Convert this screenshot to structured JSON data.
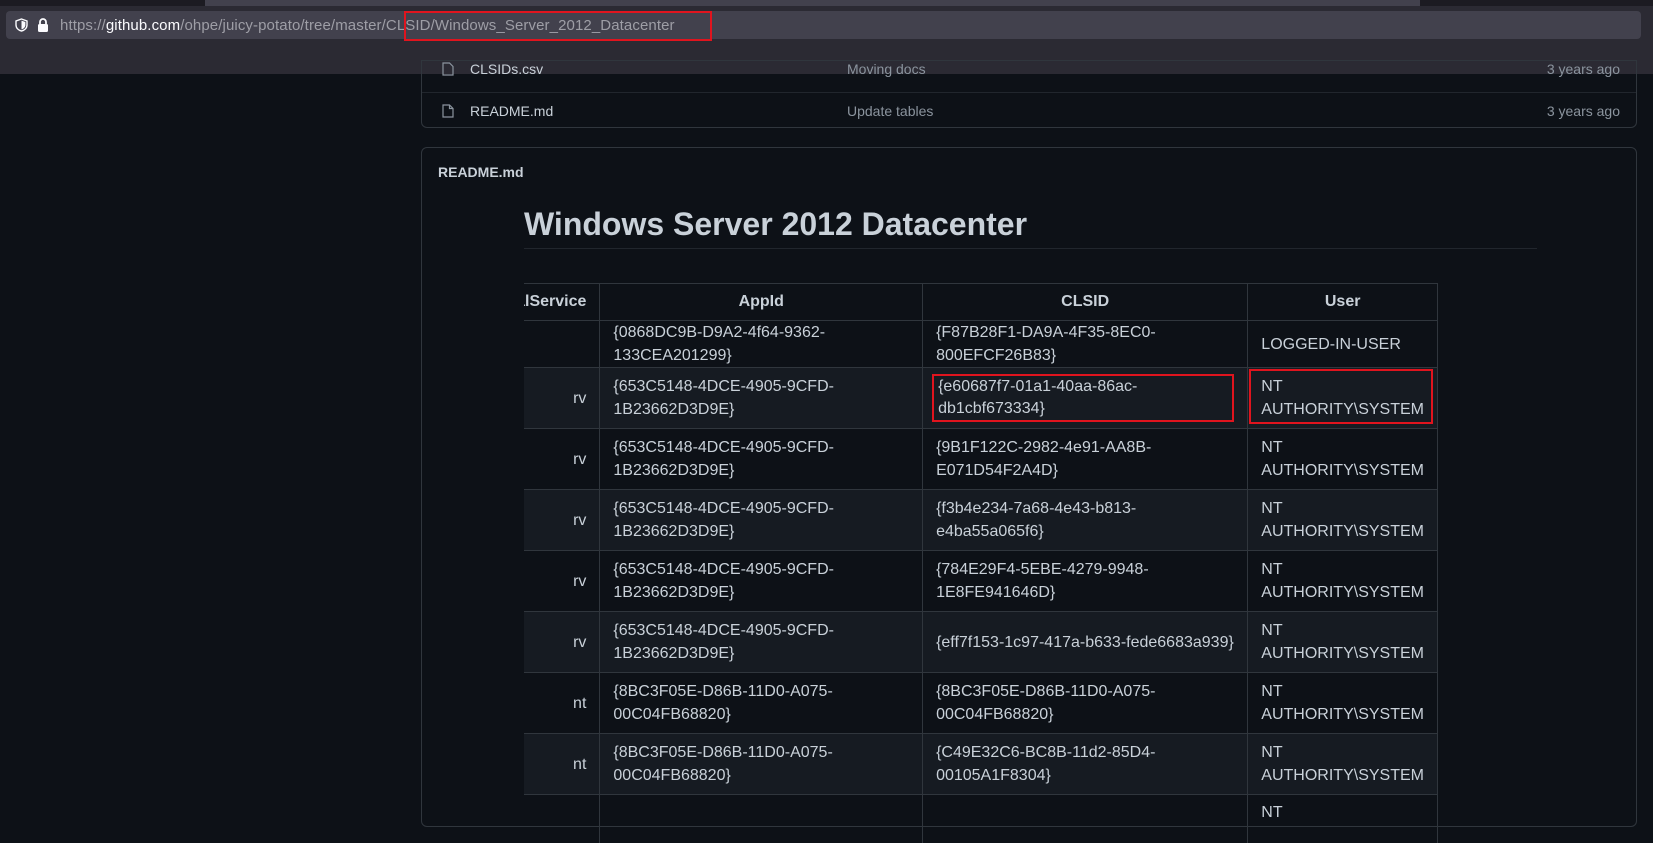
{
  "browser": {
    "url_prefix": "https://",
    "url_host": "github.com",
    "url_path": "/ohpe/juicy-potato/tree/master/CLSID/Windows_Server_2012_Datacenter"
  },
  "file_list": [
    {
      "name": "CLSIDs.csv",
      "message": "Moving docs",
      "age": "3 years ago"
    },
    {
      "name": "README.md",
      "message": "Update tables",
      "age": "3 years ago"
    }
  ],
  "readme": {
    "header": "README.md",
    "title": "Windows Server 2012 Datacenter",
    "columns": [
      "LocalService",
      "AppId",
      "CLSID",
      "User"
    ],
    "rows": [
      {
        "service": "",
        "appid": "{0868DC9B-D9A2-4f64-9362-133CEA201299}",
        "clsid": "{F87B28F1-DA9A-4F35-8EC0-800EFCF26B83}",
        "user_line1": "LOGGED-IN-USER",
        "user_line2": ""
      },
      {
        "service": "rv",
        "appid_line1": "{653C5148-4DCE-4905-9CFD-",
        "appid_line2": "1B23662D3D9E}",
        "clsid": "{e60687f7-01a1-40aa-86ac-db1cbf673334}",
        "user_line1": "NT",
        "user_line2": "AUTHORITY\\SYSTEM"
      },
      {
        "service": "rv",
        "appid_line1": "{653C5148-4DCE-4905-9CFD-",
        "appid_line2": "1B23662D3D9E}",
        "clsid": "{9B1F122C-2982-4e91-AA8B-E071D54F2A4D}",
        "user_line1": "NT",
        "user_line2": "AUTHORITY\\SYSTEM"
      },
      {
        "service": "rv",
        "appid_line1": "{653C5148-4DCE-4905-9CFD-",
        "appid_line2": "1B23662D3D9E}",
        "clsid": "{f3b4e234-7a68-4e43-b813-e4ba55a065f6}",
        "user_line1": "NT",
        "user_line2": "AUTHORITY\\SYSTEM"
      },
      {
        "service": "rv",
        "appid_line1": "{653C5148-4DCE-4905-9CFD-",
        "appid_line2": "1B23662D3D9E}",
        "clsid": "{784E29F4-5EBE-4279-9948-1E8FE941646D}",
        "user_line1": "NT",
        "user_line2": "AUTHORITY\\SYSTEM"
      },
      {
        "service": "rv",
        "appid_line1": "{653C5148-4DCE-4905-9CFD-",
        "appid_line2": "1B23662D3D9E}",
        "clsid": "{eff7f153-1c97-417a-b633-fede6683a939}",
        "user_line1": "NT",
        "user_line2": "AUTHORITY\\SYSTEM"
      },
      {
        "service": "nt",
        "appid": "{8BC3F05E-D86B-11D0-A075-00C04FB68820}",
        "clsid": "{8BC3F05E-D86B-11D0-A075-00C04FB68820}",
        "user_line1": "NT",
        "user_line2": "AUTHORITY\\SYSTEM"
      },
      {
        "service": "nt",
        "appid": "{8BC3F05E-D86B-11D0-A075-00C04FB68820}",
        "clsid": "{C49E32C6-BC8B-11d2-85D4-00105A1F8304}",
        "user_line1": "NT",
        "user_line2": "AUTHORITY\\SYSTEM"
      },
      {
        "service": "",
        "appid": "",
        "clsid": "",
        "user_line1": "NT",
        "user_line2": ""
      }
    ]
  }
}
